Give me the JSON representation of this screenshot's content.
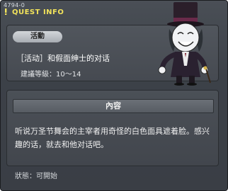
{
  "header": {
    "quest_id": "4794-0",
    "title": "QUEST INFO"
  },
  "quest": {
    "tag": "活動",
    "name": "［活动］和假面绅士的对话",
    "recommended_level": "建議等級：10～14"
  },
  "content": {
    "header": "內容",
    "text": "听说万圣节舞会的主宰者用奇怪的白色面具遮着脸。感兴趣的话，就去和他对话吧。"
  },
  "status": {
    "text": "狀態：可開始"
  },
  "npc": {
    "icon": "masked-gentleman-npc"
  },
  "colors": {
    "title_accent": "#f2e35b",
    "panel": "#464a51",
    "window": "#3c4148"
  }
}
